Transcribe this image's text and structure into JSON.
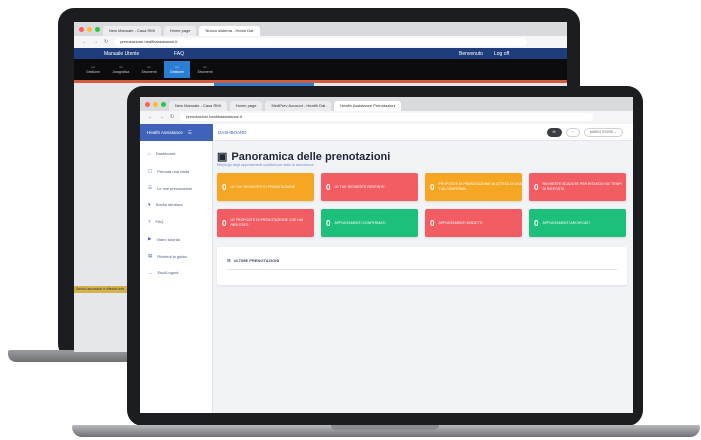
{
  "back_browser": {
    "tabs": [
      "New Manuale - Casa RMI",
      "Home page"
    ],
    "active_tab": "Nuovo sistema - Home Dat",
    "url": "prenotazione.healthassistance.it",
    "nav_left": "Manuale Utente",
    "nav_mid": "FAQ",
    "nav_right1": "Benvenuto",
    "nav_right2": "Log off",
    "toolbar": [
      "Gestione",
      "Anagrafica",
      "Strumenti",
      "Gestione",
      "Strumenti"
    ],
    "yellow_note": "Servizi accessori e ulteriori info"
  },
  "front_browser": {
    "tabs": [
      "New Manuale - Casa RMI",
      "Home page",
      "MedPrev Account - Health Dat"
    ],
    "active_tab": "Health Assistance Prenotazioni",
    "url": "prenotazioni.healthassistance.it"
  },
  "app": {
    "brand": "Health Assistance",
    "topbar_title": "DASHBOARD",
    "user_label": "MARIO ROSSI",
    "sidebar": [
      {
        "icon": "home-icon",
        "glyph": "⌂",
        "label": "Dashboard"
      },
      {
        "icon": "calendar-icon",
        "glyph": "▢",
        "label": "Prenota una visita"
      },
      {
        "icon": "list-icon",
        "glyph": "☰",
        "label": "Le mie prenotazioni"
      },
      {
        "icon": "heart-icon",
        "glyph": "♥",
        "label": "Scelta struttura"
      },
      {
        "icon": "help-icon",
        "glyph": "?",
        "label": "FAQ"
      },
      {
        "icon": "video-icon",
        "glyph": "▶",
        "label": "Video tutorial"
      },
      {
        "icon": "document-icon",
        "glyph": "▤",
        "label": "Richiedi la guida"
      },
      {
        "icon": "logout-icon",
        "glyph": "→",
        "label": "Esci/Logout"
      }
    ],
    "page_title": "Panoramica delle prenotazioni",
    "page_subtitle": "Riepilogo degli appuntamenti suddivisi per stato di lavorazione",
    "cards": [
      {
        "count": "0",
        "label": "LE TUE RICHIESTE DI PRENOTAZIONE",
        "color": "#f5a623"
      },
      {
        "count": "0",
        "label": "LE TUE RICHIESTE RESPINTE",
        "color": "#f25d63"
      },
      {
        "count": "0",
        "label": "PROPOSTE DI PRENOTAZIONE IN ATTESA DI UNA TUA CONFERMA",
        "color": "#f5a623"
      },
      {
        "count": "0",
        "label": "RICHIESTE SCADUTE PER RITARDO SUI TEMPI DI RISPOSTA",
        "color": "#f25d63"
      },
      {
        "count": "0",
        "label": "LE PROPOSTE DI PRENOTAZIONE CHE HAI RIFIUTATO",
        "color": "#f25d63"
      },
      {
        "count": "0",
        "label": "APPUNTAMENTI CONFERMATI",
        "color": "#1cc07a"
      },
      {
        "count": "0",
        "label": "APPUNTAMENTI DISDETTI",
        "color": "#f25d63"
      },
      {
        "count": "0",
        "label": "APPUNTAMENTI ARCHIVIATI",
        "color": "#1cc07a"
      }
    ],
    "recent_title": "ULTIME PRENOTAZIONI"
  }
}
